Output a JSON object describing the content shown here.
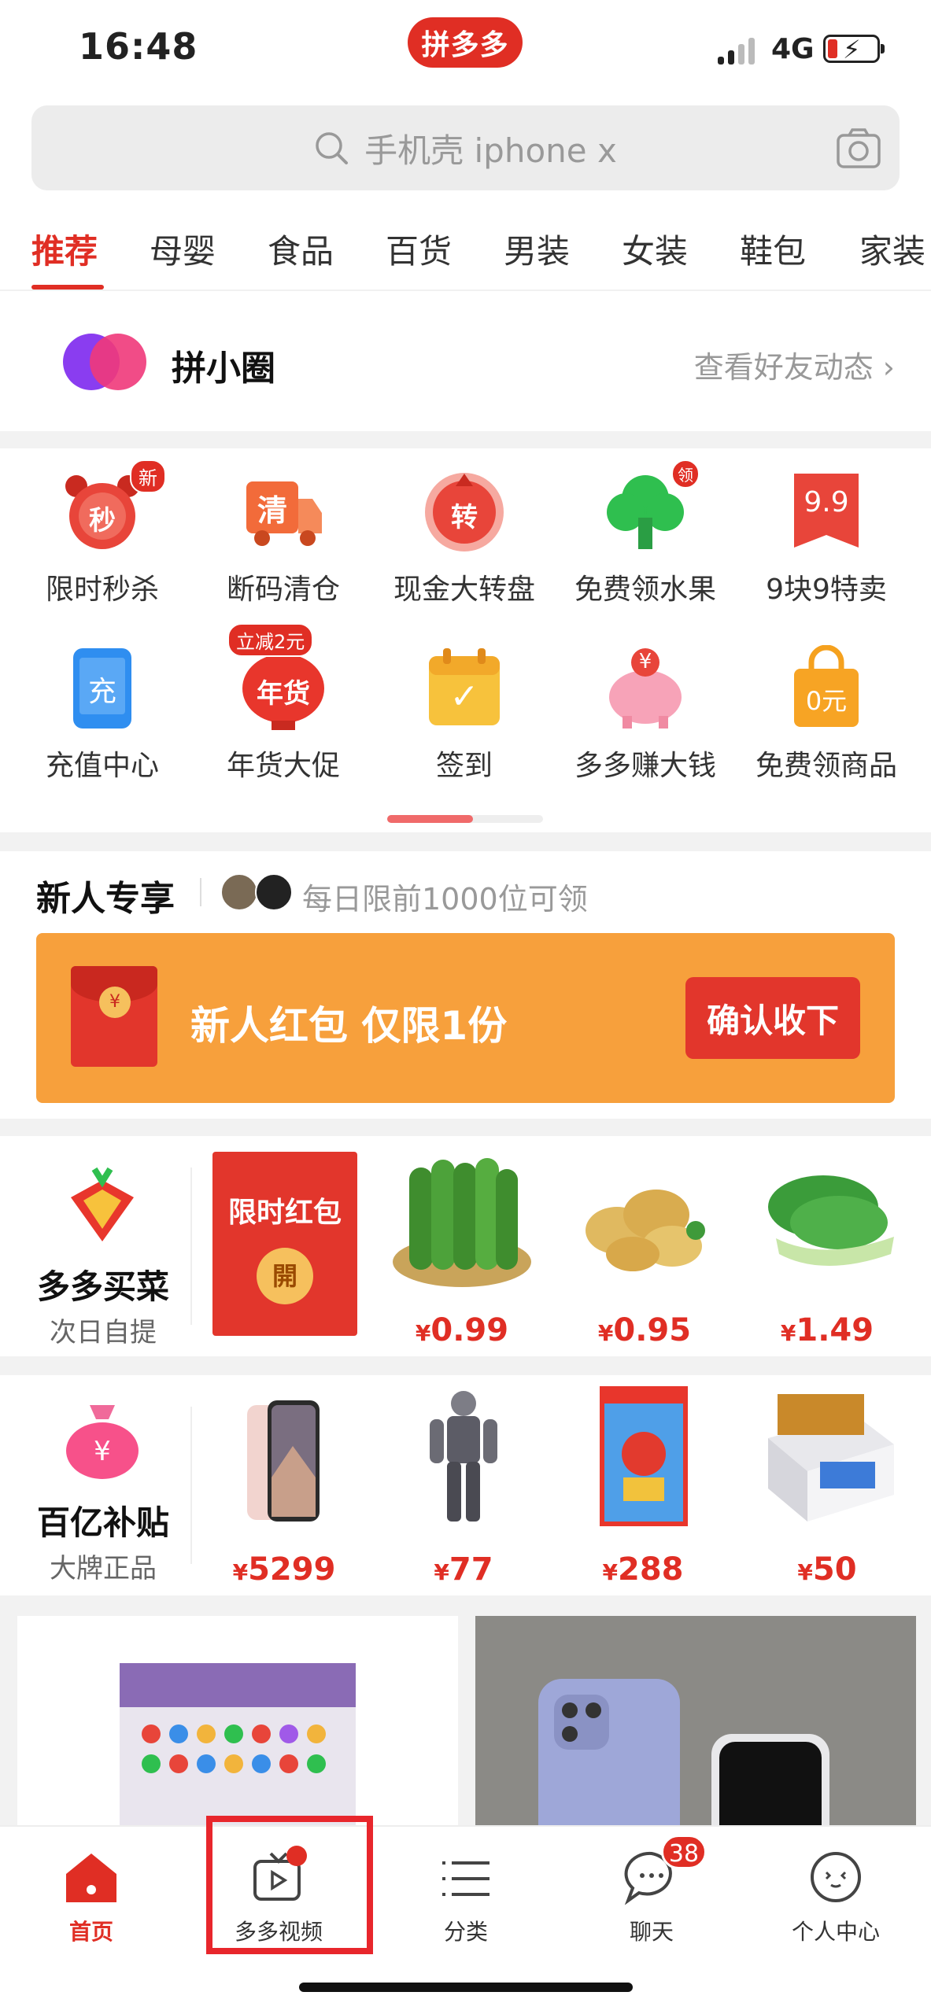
{
  "status": {
    "time": "16:48",
    "network": "4G",
    "brand": "拼多多"
  },
  "search": {
    "placeholder": "手机壳 iphone x"
  },
  "tabs": [
    "推荐",
    "母婴",
    "食品",
    "百货",
    "男装",
    "女装",
    "鞋包",
    "家装"
  ],
  "circle": {
    "title": "拼小圈",
    "link": "查看好友动态 ›"
  },
  "grid": [
    {
      "label": "限时秒杀",
      "icon": "alarm-clock-icon",
      "glyph": "秒",
      "badge": "新"
    },
    {
      "label": "断码清仓",
      "icon": "truck-icon",
      "glyph": "清"
    },
    {
      "label": "现金大转盘",
      "icon": "wheel-icon",
      "glyph": "转"
    },
    {
      "label": "免费领水果",
      "icon": "tree-icon",
      "badge": "领"
    },
    {
      "label": "9块9特卖",
      "icon": "price-tag-icon",
      "glyph": "9.9"
    },
    {
      "label": "充值中心",
      "icon": "phone-topup-icon",
      "glyph": "充"
    },
    {
      "label": "年货大促",
      "icon": "lantern-icon",
      "glyph": "年货",
      "badge": "立减2元"
    },
    {
      "label": "签到",
      "icon": "calendar-check-icon",
      "glyph": "✓"
    },
    {
      "label": "多多赚大钱",
      "icon": "piggy-bank-icon",
      "glyph": "¥"
    },
    {
      "label": "免费领商品",
      "icon": "shopping-bag-icon",
      "glyph": "0元"
    }
  ],
  "pager": {
    "progress": 0.55
  },
  "newcomer": {
    "title": "新人专享",
    "subtitle": "每日限前1000位可领",
    "banner_text": "新人红包 仅限1份",
    "button": "确认收下",
    "coin": "¥"
  },
  "grocery": {
    "title": "多多买菜",
    "subtitle": "次日自提",
    "redpacket": {
      "title": "限时红包",
      "open": "開"
    },
    "products": [
      {
        "name": "cucumber-image",
        "currency": "¥",
        "price": "0.99"
      },
      {
        "name": "potato-image",
        "currency": "¥",
        "price": "0.95"
      },
      {
        "name": "bok-choy-image",
        "currency": "¥",
        "price": "1.49"
      }
    ]
  },
  "subsidy": {
    "title": "百亿补贴",
    "subtitle": "大牌正品",
    "products": [
      {
        "name": "iphone-image",
        "currency": "¥",
        "price": "5299"
      },
      {
        "name": "action-figure-image",
        "currency": "¥",
        "price": "77"
      },
      {
        "name": "mario-game-image",
        "currency": "¥",
        "price": "288"
      },
      {
        "name": "card-box-image",
        "currency": "¥",
        "price": "50"
      }
    ]
  },
  "bottom_nav": [
    {
      "label": "首页",
      "icon": "home-icon"
    },
    {
      "label": "多多视频",
      "icon": "video-icon"
    },
    {
      "label": "分类",
      "icon": "list-icon"
    },
    {
      "label": "聊天",
      "icon": "chat-icon",
      "count": "38"
    },
    {
      "label": "个人中心",
      "icon": "profile-icon"
    }
  ],
  "colors": {
    "brand": "#e02e24",
    "banner": "#f7a03c",
    "highlight": "#e8262c"
  }
}
